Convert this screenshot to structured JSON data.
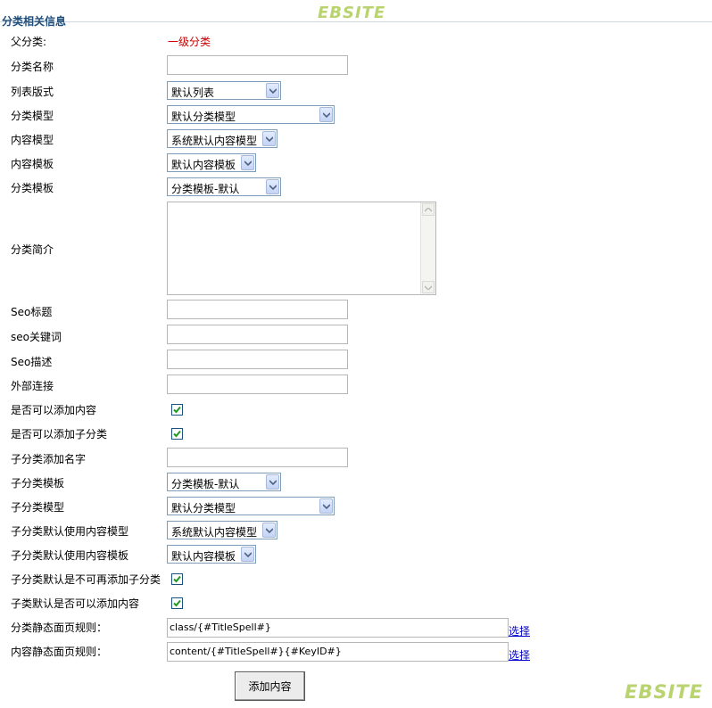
{
  "logo_text": "EBSITE",
  "section_title": "分类相关信息",
  "parent": {
    "label": "父分类:",
    "value": "一级分类"
  },
  "labels": {
    "name": "分类名称",
    "list_style": "列表版式",
    "class_model": "分类模型",
    "content_model": "内容模型",
    "content_template": "内容模板",
    "class_template": "分类模板",
    "intro": "分类简介",
    "seo_title": "Seo标题",
    "seo_keywords": "seo关键词",
    "seo_desc": "Seo描述",
    "external_link": "外部连接",
    "can_add_content": "是否可以添加内容",
    "can_add_child": "是否可以添加子分类",
    "child_name": "子分类添加名字",
    "child_template": "子分类模板",
    "child_model": "子分类模型",
    "child_default_content_model": "子分类默认使用内容模型",
    "child_default_content_template": "子分类默认使用内容模板",
    "child_no_more_child": "子分类默认是不可再添加子分类",
    "child_can_add_content": "子类默认是否可以添加内容",
    "class_static_rule": "分类静态面页规则：",
    "content_static_rule": "内容静态面页规则："
  },
  "values": {
    "name": "",
    "list_style": "默认列表",
    "class_model": "默认分类模型",
    "content_model": "系统默认内容模型",
    "content_template": "默认内容模板",
    "class_template": "分类模板-默认",
    "intro": "",
    "seo_title": "",
    "seo_keywords": "",
    "seo_desc": "",
    "external_link": "",
    "can_add_content": true,
    "can_add_child": true,
    "child_name": "",
    "child_template": "分类模板-默认",
    "child_model": "默认分类模型",
    "child_default_content_model": "系统默认内容模型",
    "child_default_content_template": "默认内容模板",
    "child_no_more_child": true,
    "child_can_add_content": true,
    "class_static_rule": "class/{#TitleSpell#}",
    "content_static_rule": "content/{#TitleSpell#}{#KeyID#}"
  },
  "select_link_label": "选择",
  "submit_label": "添加内容",
  "icons": {
    "dropdown": "chevron-down-icon",
    "check": "checkmark-icon"
  },
  "colors": {
    "title": "#1f4d7a",
    "parent_value": "#cc0000",
    "link": "#0000cc",
    "logo": "#b9d46f",
    "checkbox_check": "#1f9a1f"
  }
}
